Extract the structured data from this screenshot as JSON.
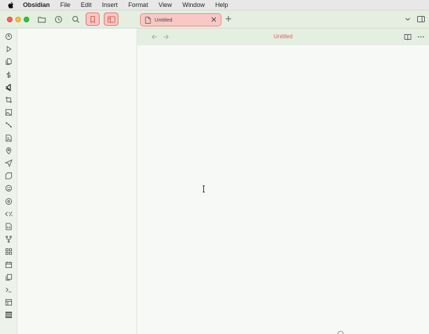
{
  "menubar": {
    "apple_icon": "apple-icon",
    "items": [
      "Obsidian",
      "File",
      "Edit",
      "Insert",
      "Format",
      "View",
      "Window",
      "Help"
    ]
  },
  "window": {
    "traffic_lights": [
      "close",
      "minimize",
      "zoom"
    ],
    "toolbar_icons": [
      "folder-icon",
      "clock-icon",
      "search-icon",
      "bookmark-icon",
      "sidebar-toggle-icon"
    ],
    "tab": {
      "title": "Untitled"
    },
    "right_icons": [
      "chevron-down-icon",
      "right-sidebar-icon"
    ]
  },
  "ribbon": {
    "icons": [
      "search-icon",
      "play-icon",
      "files-icon",
      "dollar-icon",
      "vscode-icon",
      "crop-icon",
      "image-icon",
      "graph-icon",
      "file-image-icon",
      "map-pin-icon",
      "send-icon",
      "tag-icon",
      "palette-icon",
      "disc-icon",
      "code-percent-icon",
      "file-code-icon",
      "git-fork-icon",
      "grid-icon",
      "calendar-icon",
      "copy-icon",
      "terminal-icon",
      "layout-icon",
      "table-icon"
    ]
  },
  "editor": {
    "title": "Untitled"
  },
  "colors": {
    "accent": "#e0605a",
    "tab_bg": "#f9c8c4",
    "chrome": "#e4eee1",
    "editor_bg": "#f7f9f6"
  }
}
